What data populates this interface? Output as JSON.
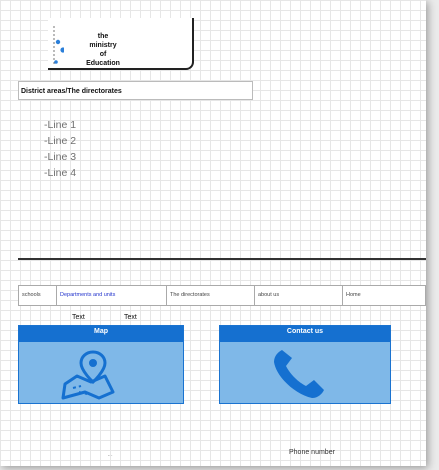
{
  "logo": {
    "lines": [
      "the",
      "ministry",
      "of",
      "Education"
    ],
    "accent_color": "#2b7fd9"
  },
  "breadcrumb": {
    "text": "District areas/The directorates"
  },
  "content": {
    "lines": [
      "-Line 1",
      "-Line 2",
      "-Line 3",
      "-Line 4"
    ]
  },
  "nav": {
    "items": [
      {
        "label": "schools",
        "active": false
      },
      {
        "label": "Departments and units",
        "active": true
      },
      {
        "label": "The directorates",
        "active": false
      },
      {
        "label": "about us",
        "active": false
      },
      {
        "label": "Home",
        "active": false
      }
    ],
    "active_color": "#2233cc"
  },
  "text_labels": [
    "Text",
    "Text"
  ],
  "cards": {
    "map": {
      "title": "Map",
      "icon": "map-pin-icon"
    },
    "contact": {
      "title": "Contact us",
      "icon": "phone-icon"
    },
    "header_color": "#1570d0",
    "body_color": "#7fb8e8"
  },
  "footer": {
    "small_text": "-  ·",
    "phone_label": "Phone number"
  }
}
